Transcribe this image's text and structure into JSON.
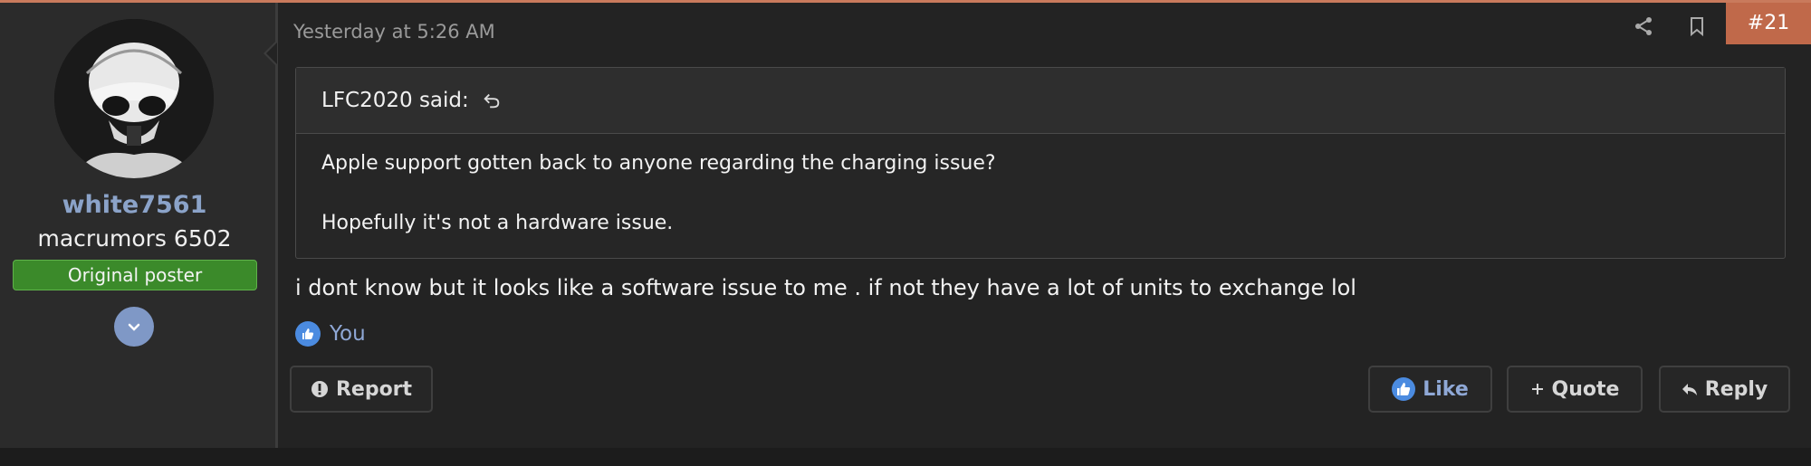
{
  "post": {
    "timestamp": "Yesterday at 5:26 AM",
    "number": "#21",
    "author": {
      "username": "white7561",
      "title": "macrumors 6502",
      "badge": "Original poster"
    },
    "quote": {
      "attribution": "LFC2020 said:",
      "lines": [
        "Apple support gotten back to anyone regarding the charging issue?",
        "Hopefully it's not a hardware issue."
      ]
    },
    "message": "i dont know but it looks like a software issue to me . if not they have a lot of units to exchange lol",
    "likes_text": "You",
    "actions": {
      "report": "Report",
      "like": "Like",
      "quote": "Quote",
      "reply": "Reply"
    }
  },
  "icons": {
    "share": "share-icon",
    "bookmark": "bookmark-icon",
    "expand": "chevron-down-icon",
    "quote_jump": "jump-back-icon",
    "like": "thumbs-up-icon",
    "report": "exclamation-icon",
    "quote": "plus-icon",
    "reply": "reply-arrow-icon"
  },
  "colors": {
    "accent_post_number": "#c0694a",
    "username": "#8ba3c9",
    "badge": "#3b8a2a",
    "like": "#4b8be0"
  }
}
